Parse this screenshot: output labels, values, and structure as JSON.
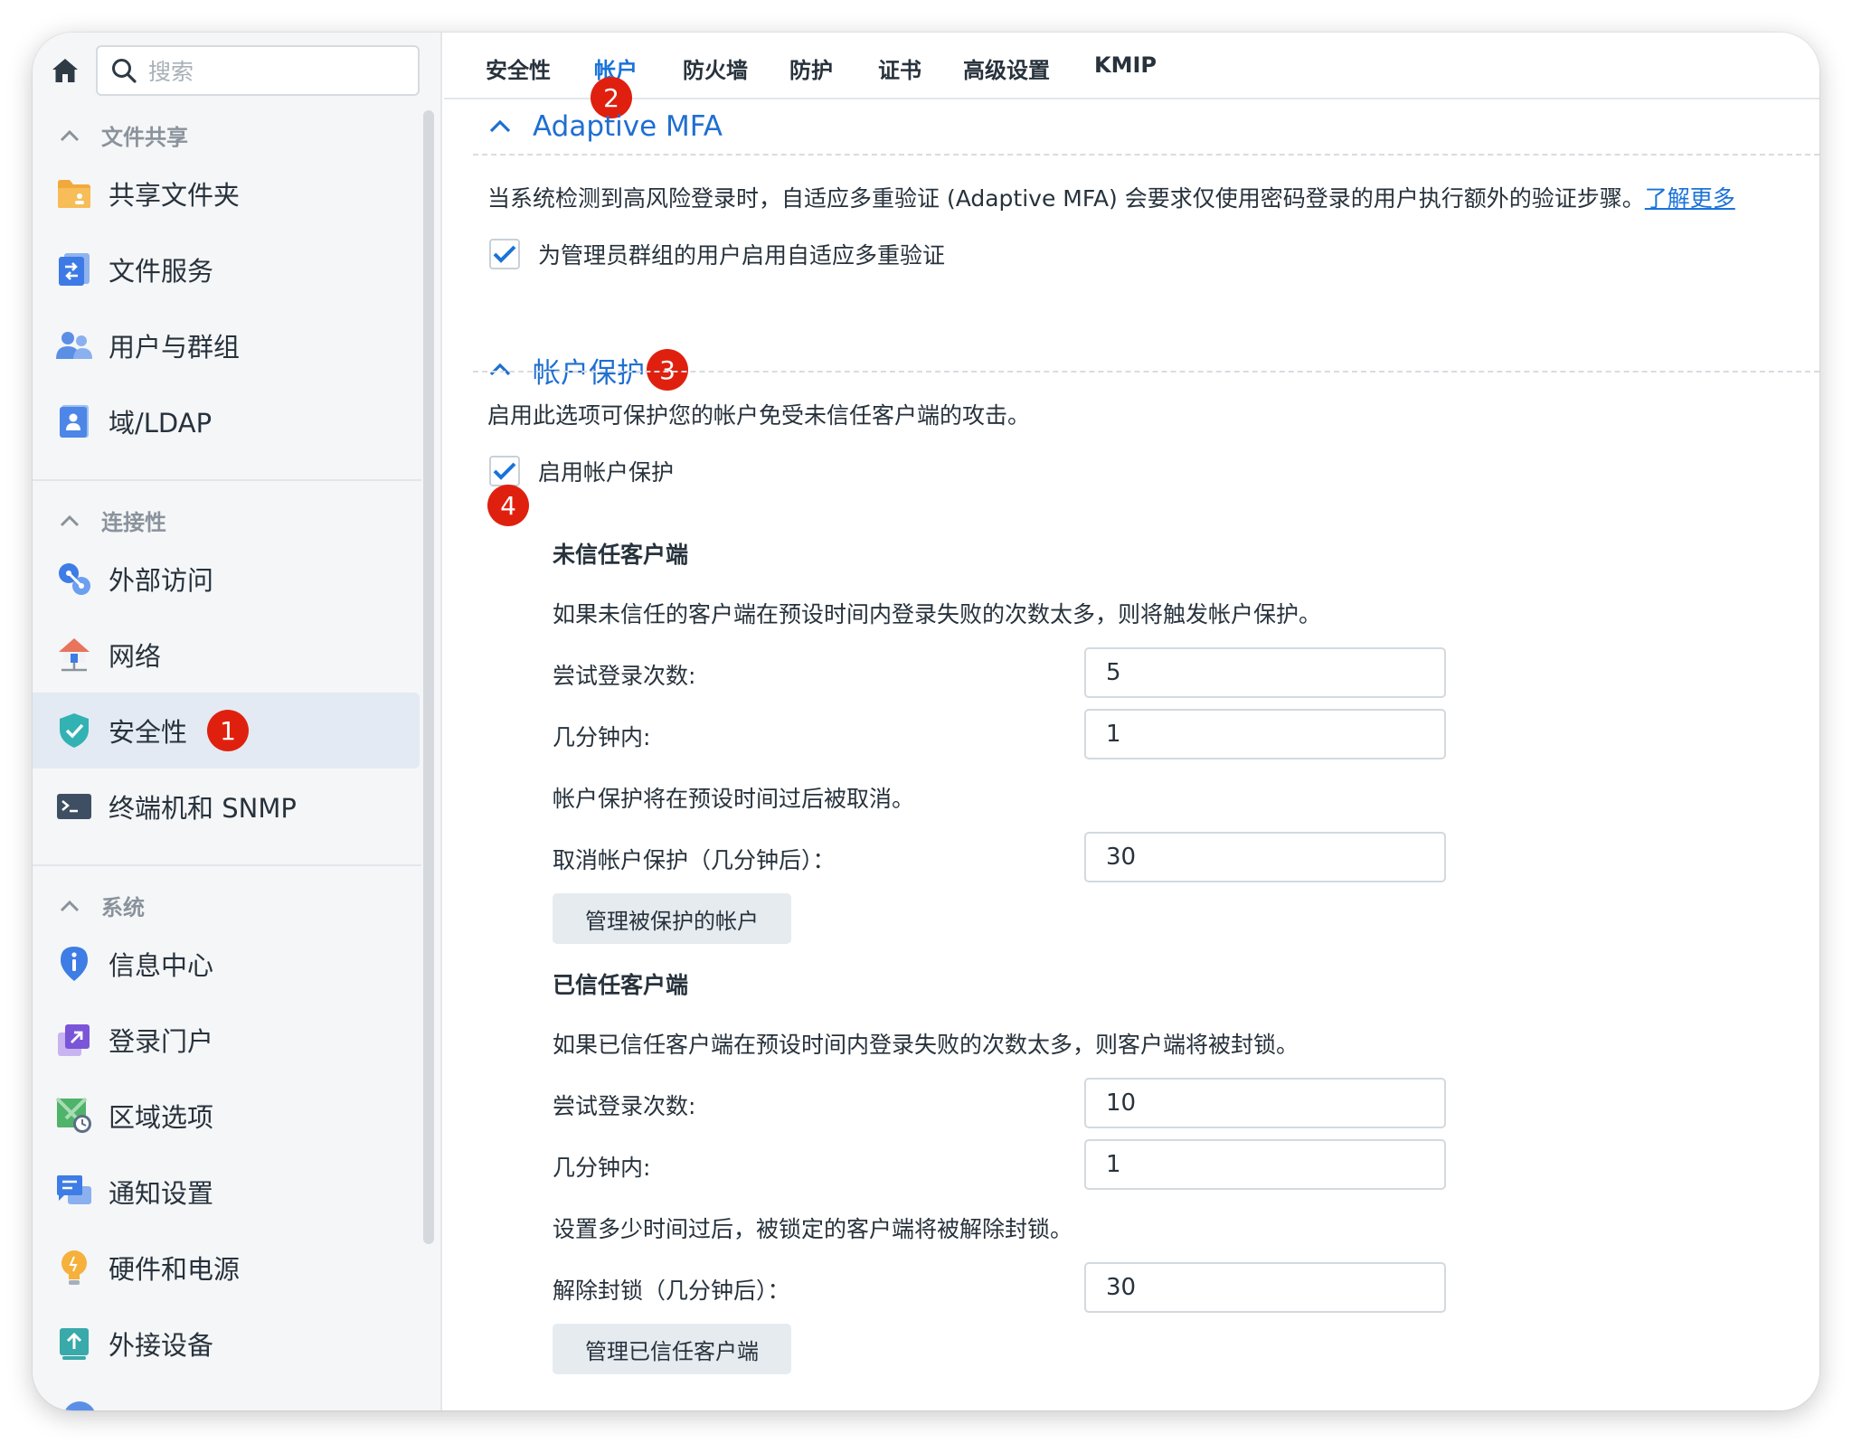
{
  "search": {
    "placeholder": "搜索"
  },
  "sidebar": {
    "sections": [
      {
        "label": "文件共享"
      },
      {
        "label": "连接性"
      },
      {
        "label": "系统"
      }
    ],
    "items": [
      {
        "label": "共享文件夹"
      },
      {
        "label": "文件服务"
      },
      {
        "label": "用户与群组"
      },
      {
        "label": "域/LDAP"
      },
      {
        "label": "外部访问"
      },
      {
        "label": "网络"
      },
      {
        "label": "安全性",
        "active": true
      },
      {
        "label": "终端机和 SNMP"
      },
      {
        "label": "信息中心"
      },
      {
        "label": "登录门户"
      },
      {
        "label": "区域选项"
      },
      {
        "label": "通知设置"
      },
      {
        "label": "硬件和电源"
      },
      {
        "label": "外接设备"
      }
    ]
  },
  "tabs": [
    {
      "label": "安全性"
    },
    {
      "label": "帐户",
      "active": true
    },
    {
      "label": "防火墙"
    },
    {
      "label": "防护"
    },
    {
      "label": "证书"
    },
    {
      "label": "高级设置"
    },
    {
      "label": "KMIP"
    }
  ],
  "badges": {
    "b1": "1",
    "b2": "2",
    "b3": "3",
    "b4": "4"
  },
  "mfa": {
    "title": "Adaptive MFA",
    "description": "当系统检测到高风险登录时，自适应多重验证 (Adaptive MFA) 会要求仅使用密码登录的用户执行额外的验证步骤。",
    "learn_more": "了解更多",
    "checkbox_label": "为管理员群组的用户启用自适应多重验证",
    "checked": true
  },
  "protection": {
    "title": "帐户保护",
    "description": "启用此选项可保护您的帐户免受未信任客户端的攻击。",
    "checkbox_label": "启用帐户保护",
    "checked": true,
    "untrusted": {
      "title": "未信任客户端",
      "description": "如果未信任的客户端在预设时间内登录失败的次数太多，则将触发帐户保护。",
      "attempts_label": "尝试登录次数:",
      "attempts_value": "5",
      "minutes_label": "几分钟内:",
      "minutes_value": "1",
      "cancel_note": "帐户保护将在预设时间过后被取消。",
      "cancel_label": "取消帐户保护（几分钟后）：",
      "cancel_value": "30",
      "manage_button": "管理被保护的帐户"
    },
    "trusted": {
      "title": "已信任客户端",
      "description": "如果已信任客户端在预设时间内登录失败的次数太多，则客户端将被封锁。",
      "attempts_label": "尝试登录次数:",
      "attempts_value": "10",
      "minutes_label": "几分钟内:",
      "minutes_value": "1",
      "unblock_note": "设置多少时间过后，被锁定的客户端将被解除封锁。",
      "unblock_label": "解除封锁（几分钟后）：",
      "unblock_value": "30",
      "manage_button": "管理已信任客户端"
    }
  },
  "colors": {
    "accent": "#1a73d9",
    "badge": "#e0200f",
    "active_bg": "#e3eaf3"
  }
}
